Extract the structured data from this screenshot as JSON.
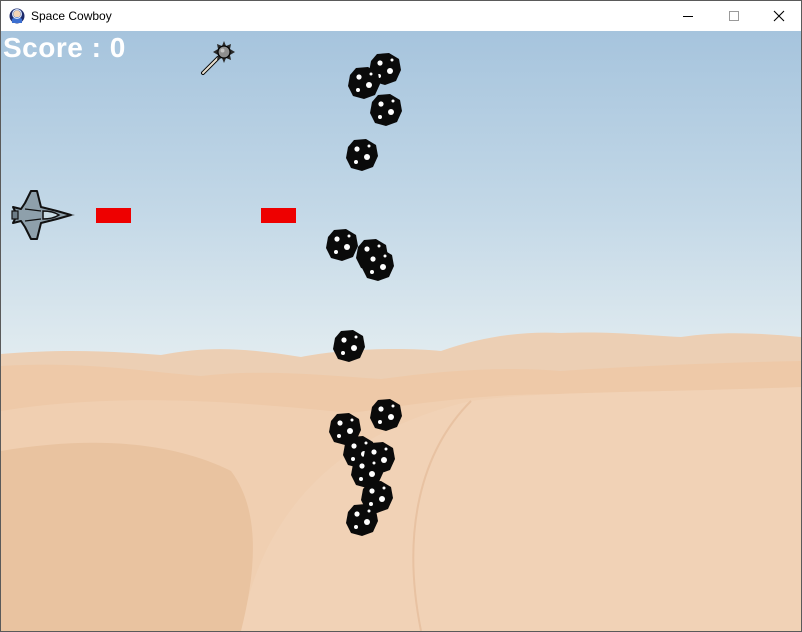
{
  "window": {
    "title": "Space Cowboy",
    "app_icon": "space-cowboy-app-icon",
    "controls": [
      "minimize-icon",
      "maximize-icon",
      "close-icon"
    ]
  },
  "hud": {
    "score_text": "Score : 0"
  },
  "scene": {
    "background": "desert-dunes-under-sky",
    "player": "fighter-jet-sprite",
    "projectiles": "red-laser-bullets",
    "powerup": "spiked-mace-powerup",
    "enemies": "black-asteroid-sprites"
  },
  "colors": {
    "sky_top": "#a9c7df",
    "sky_bottom": "#e3edf1",
    "sand": "#ecc9a8",
    "bullet": "#ee0000",
    "asteroid": "#0a0a0a",
    "score": "#ffffff"
  }
}
